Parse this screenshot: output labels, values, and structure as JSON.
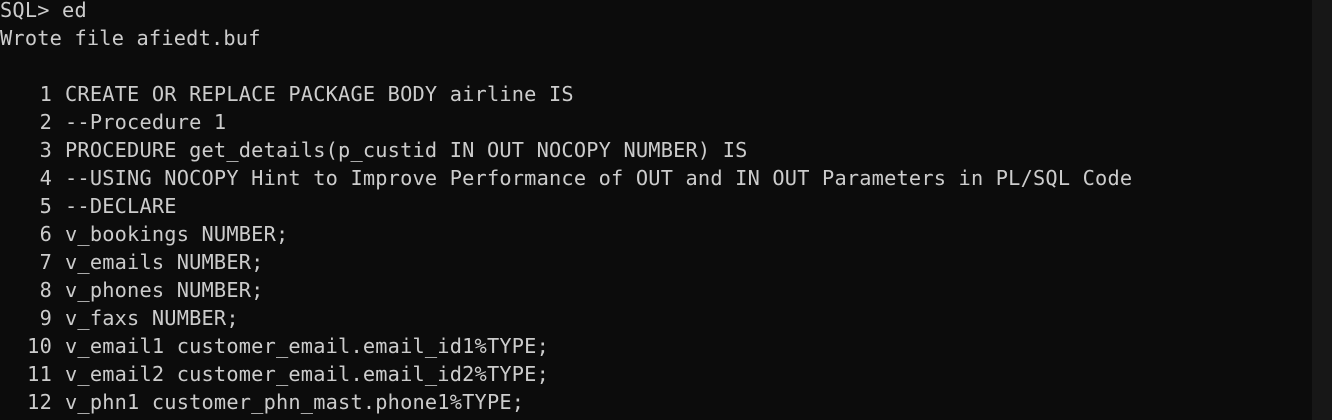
{
  "terminal": {
    "colors": {
      "background": "#0c0c0c",
      "foreground": "#cccccc"
    },
    "prompt_line": "SQL> ed",
    "status_line": "Wrote file afiedt.buf",
    "listing": [
      {
        "num": "1",
        "text": "CREATE OR REPLACE PACKAGE BODY airline IS"
      },
      {
        "num": "2",
        "text": "--Procedure 1"
      },
      {
        "num": "3",
        "text": "PROCEDURE get_details(p_custid IN OUT NOCOPY NUMBER) IS"
      },
      {
        "num": "4",
        "text": "--USING NOCOPY Hint to Improve Performance of OUT and IN OUT Parameters in PL/SQL Code"
      },
      {
        "num": "5",
        "text": "--DECLARE"
      },
      {
        "num": "6",
        "text": "v_bookings NUMBER;"
      },
      {
        "num": "7",
        "text": "v_emails NUMBER;"
      },
      {
        "num": "8",
        "text": "v_phones NUMBER;"
      },
      {
        "num": "9",
        "text": "v_faxs NUMBER;"
      },
      {
        "num": "10",
        "text": "v_email1 customer_email.email_id1%TYPE;"
      },
      {
        "num": "11",
        "text": "v_email2 customer_email.email_id2%TYPE;"
      },
      {
        "num": "12",
        "text": "v_phn1 customer_phn_mast.phone1%TYPE;"
      }
    ]
  }
}
